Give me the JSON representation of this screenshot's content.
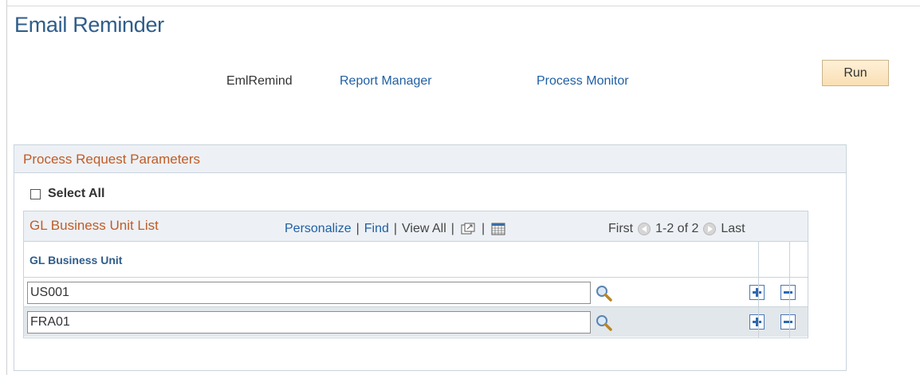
{
  "page": {
    "title": "Email Reminder"
  },
  "run_control": {
    "label": "EmlRemind",
    "report_manager": "Report Manager",
    "process_monitor": "Process Monitor",
    "run_button": "Run"
  },
  "panel": {
    "title": "Process Request Parameters",
    "select_all": {
      "label": "Select All",
      "checked": false
    }
  },
  "grid": {
    "title": "GL Business Unit List",
    "toolbar": {
      "personalize": "Personalize",
      "find": "Find",
      "view_all": "View All",
      "zoom_icon": "new-window-icon",
      "download_icon": "spreadsheet-icon"
    },
    "navigation": {
      "first": "First",
      "range": "1-2 of 2",
      "last": "Last"
    },
    "column_header": "GL Business Unit",
    "rows": [
      {
        "value": "US001"
      },
      {
        "value": "FRA01"
      }
    ]
  },
  "colors": {
    "title": "#2f5d8a",
    "link": "#1f5fa5",
    "section_title": "#c05c28",
    "header_bg": "#edf1f5",
    "alt_row_bg": "#e2e7eb",
    "run_button_bg": "#f9dfb3"
  }
}
